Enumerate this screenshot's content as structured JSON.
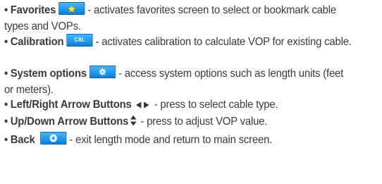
{
  "items": [
    {
      "bullet": "•",
      "label": "Favorites",
      "text": " - activates favorites screen to select or bookmark cable types and VOPs.",
      "icon": "star-key-icon"
    },
    {
      "bullet": "•",
      "label": "Calibration",
      "key_text": "CAL",
      "text": " - activates calibration to calculate VOP for existing cable.",
      "icon": "cal-key-icon"
    },
    {
      "bullet": "•",
      "label": "System options",
      "text": " - access system options such as length units (feet or meters).",
      "icon": "gear-key-icon"
    },
    {
      "bullet": "•",
      "label": "Left/Right Arrow Buttons",
      "text": "  -  press to select cable type.",
      "icon": "left-right-arrow-icon"
    },
    {
      "bullet": "•",
      "label": "Up/Down Arrow Buttons",
      "text": " - press to adjust VOP value.",
      "icon": "up-down-arrow-icon"
    },
    {
      "bullet": "•",
      "label": "Back",
      "text": " - exit length mode and return to main screen.",
      "icon": "back-key-icon"
    }
  ],
  "colors": {
    "key_fill": "#1e96ec",
    "text": "#3a3a3a"
  }
}
